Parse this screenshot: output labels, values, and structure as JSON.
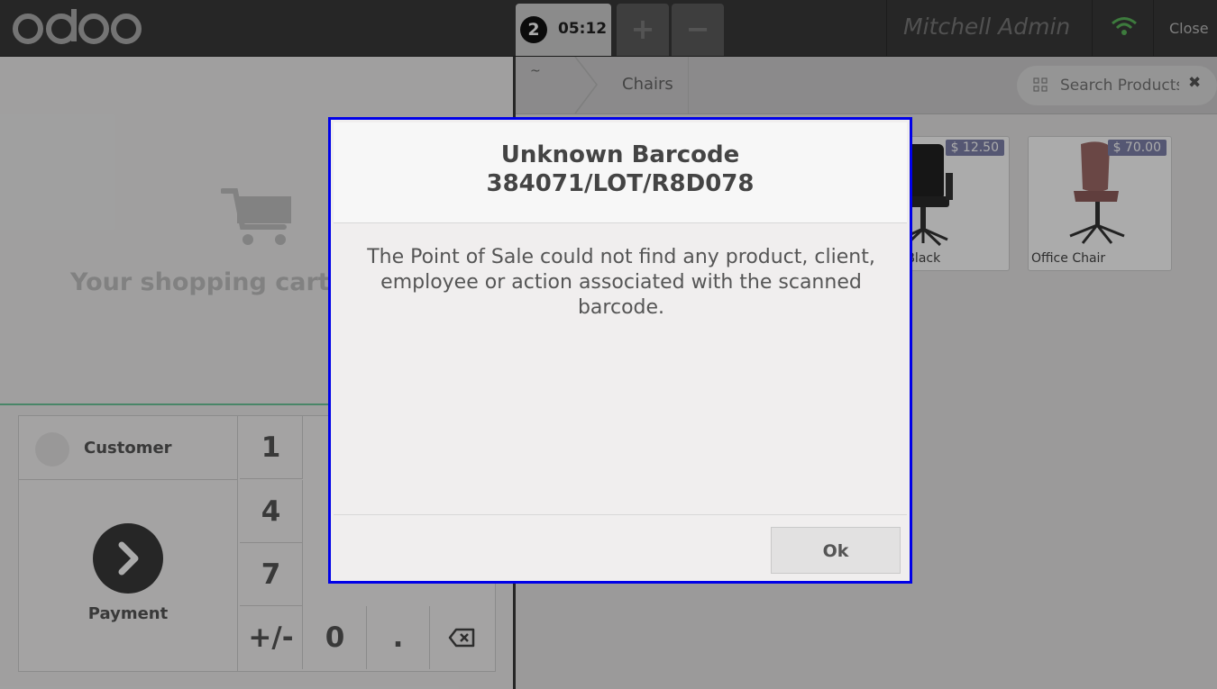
{
  "header": {
    "logo": "odoo",
    "order": {
      "number": "2",
      "time": "05:12"
    },
    "add_order": "+",
    "remove_order": "−",
    "cashier": "Mitchell Admin",
    "close": "Close"
  },
  "cart": {
    "empty_text": "Your shopping cart"
  },
  "control": {
    "customer": "Customer",
    "payment": "Payment",
    "keys": [
      "1",
      "4",
      "7",
      "+/-",
      "0",
      "."
    ]
  },
  "breadcrumb": {
    "home": "~",
    "category": "Chairs"
  },
  "search": {
    "placeholder": "Search Products"
  },
  "products": [
    {
      "name": "Chair Black",
      "price": "$ 12.50"
    },
    {
      "name": "Office Chair",
      "price": "$ 70.00"
    }
  ],
  "dialog": {
    "title_line1": "Unknown Barcode",
    "title_line2": "384071/LOT/R8D078",
    "body": "The Point of Sale could not find any product, client, employee or action associated with the scanned barcode.",
    "ok": "Ok"
  }
}
